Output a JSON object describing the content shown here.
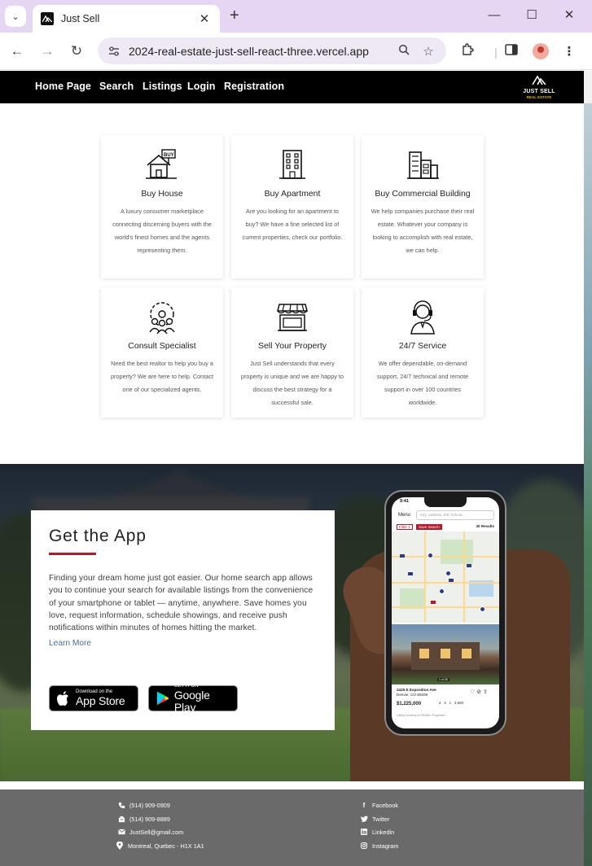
{
  "browser": {
    "tab_title": "Just Sell",
    "url": "2024-real-estate-just-sell-react-three.vercel.app",
    "icons": [
      "tab-search-icon",
      "close-icon",
      "new-tab-icon",
      "minimize-icon",
      "maximize-icon",
      "close-window-icon",
      "back-icon",
      "forward-icon",
      "reload-icon",
      "site-settings-icon",
      "zoom-icon",
      "bookmark-star-icon",
      "extensions-icon",
      "sidebar-icon",
      "profile-avatar",
      "kebab-menu-icon"
    ]
  },
  "site_nav": {
    "links": [
      "Home Page",
      "Search",
      "Listings",
      "Login",
      "Registration"
    ],
    "logo": {
      "title": "JUST SELL",
      "subtitle": "REAL ESTATE"
    }
  },
  "services": [
    {
      "title": "Buy House",
      "text": "A luxury consumer marketplace connecting discerning buyers with the world's finest homes and the agents representing them.",
      "icon": "house-buy-icon"
    },
    {
      "title": "Buy Apartment",
      "text": "Are you looking for an apartment to buy? We have a fine selected list of current properties, check our portfolio.",
      "icon": "apartment-building-icon"
    },
    {
      "title": "Buy Commercial Building",
      "text": "We help companies purchase their real estate. Whatever your company is looking to accomplish with real estate, we can help.",
      "icon": "commercial-buildings-icon"
    },
    {
      "title": "Consult Specialist",
      "text": "Need the best realtor to help you buy a property? We are here to help. Contact one of our specialized agents.",
      "icon": "team-gear-icon"
    },
    {
      "title": "Sell Your Property",
      "text": "Just Sell understands that every property is unique and we are happy to discuss the best strategy for a successful sale.",
      "icon": "storefront-icon"
    },
    {
      "title": "24/7 Service",
      "text": "We offer dependable, on-demand support, 24/7 technical and remote support in over 100 countries worldwide.",
      "icon": "support-agent-icon"
    }
  ],
  "app_section": {
    "title": "Get the App",
    "text": "Finding your dream home just got easier. Our home search app allows you to continue your search for available listings from the convenience of your smartphone or tablet — anytime, anywhere. Save homes you love, request information, schedule showings, and receive push notifications within minutes of homes hitting the market.",
    "link": "Learn More",
    "app_store": {
      "small": "Download on the",
      "big": "App Store"
    },
    "google_play": {
      "small": "GET IT ON",
      "big": "Google Play"
    },
    "phone": {
      "time": "9:41",
      "menu": "Menu",
      "search_placeholder": "City, Address, ZIP, School...",
      "filter": "Filter",
      "filter_count": "1",
      "save_search": "Save Search",
      "results": "30 Results",
      "address": "2425 E Exposition Ave",
      "city": "Denver, CO 80209",
      "price": "$1,225,000",
      "beds": "4",
      "baths_full": "3",
      "baths_half": "1",
      "sqft": "3,650",
      "photo_count": "1 of 35",
      "courtesy": "Listing courtesy of RE/MAX Properties"
    }
  },
  "footer": {
    "contact": [
      {
        "icon": "phone-icon",
        "text": "(514) 909-0909"
      },
      {
        "icon": "fax-icon",
        "text": "(514) 909-8889"
      },
      {
        "icon": "email-icon",
        "text": "JustSell@gmail.com"
      },
      {
        "icon": "location-pin-icon",
        "text": "Montreal, Quebec - H1X 1A1"
      }
    ],
    "social": [
      {
        "icon": "facebook-icon",
        "text": "Facebook"
      },
      {
        "icon": "twitter-icon",
        "text": "Twitter"
      },
      {
        "icon": "linkedin-icon",
        "text": "Linkedin"
      },
      {
        "icon": "instagram-icon",
        "text": "Instagram"
      }
    ]
  },
  "colors": {
    "accent": "#b5172b",
    "nav_bg": "#000000",
    "footer_bg": "#6a6a6a",
    "tab_strip": "#e7d5f4"
  }
}
